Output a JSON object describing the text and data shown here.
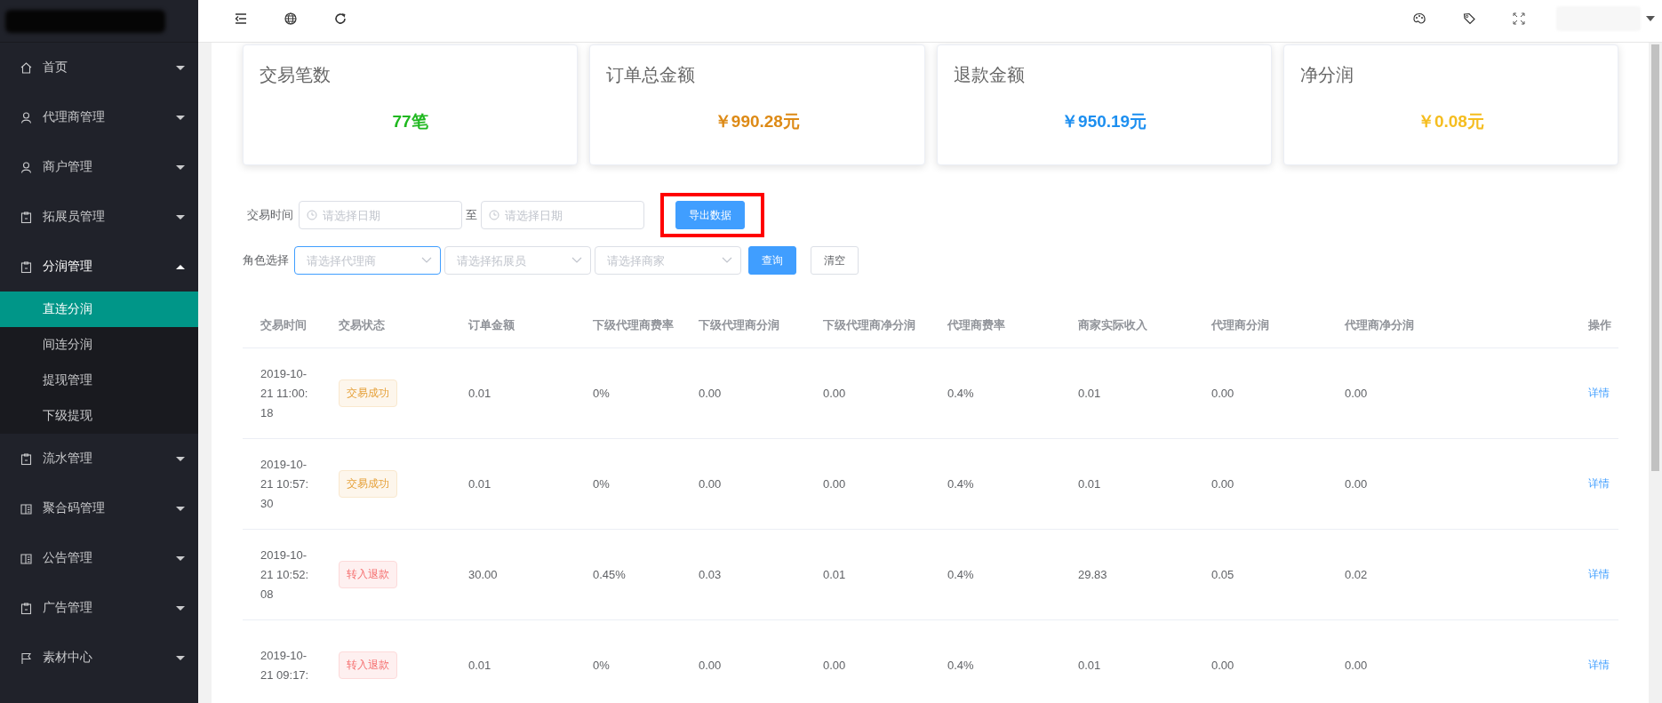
{
  "sidebar": {
    "items": [
      {
        "label": "首页",
        "expanded": false
      },
      {
        "label": "代理商管理",
        "expanded": false
      },
      {
        "label": "商户管理",
        "expanded": false
      },
      {
        "label": "拓展员管理",
        "expanded": false
      },
      {
        "label": "分润管理",
        "expanded": true,
        "children": [
          {
            "label": "直连分润",
            "selected": true
          },
          {
            "label": "间连分润",
            "selected": false
          },
          {
            "label": "提现管理",
            "selected": false
          },
          {
            "label": "下级提现",
            "selected": false
          }
        ]
      },
      {
        "label": "流水管理",
        "expanded": false
      },
      {
        "label": "聚合码管理",
        "expanded": false
      },
      {
        "label": "公告管理",
        "expanded": false
      },
      {
        "label": "广告管理",
        "expanded": false
      },
      {
        "label": "素材中心",
        "expanded": false
      }
    ]
  },
  "stats": [
    {
      "label": "交易笔数",
      "value": "77笔",
      "color": "#1fb81f"
    },
    {
      "label": "订单总金额",
      "value": "￥990.28元",
      "color": "#dd8a16"
    },
    {
      "label": "退款金额",
      "value": "￥950.19元",
      "color": "#1d8ff0"
    },
    {
      "label": "净分润",
      "value": "￥0.08元",
      "color": "#f5bd1f"
    }
  ],
  "filters": {
    "date_label": "交易时间",
    "date_from": {
      "placeholder": "请选择日期"
    },
    "date_sep": "至",
    "date_to": {
      "placeholder": "请选择日期"
    },
    "export_button": "导出数据",
    "export_highlighted": true,
    "role_label": "角色选择",
    "selects": [
      {
        "placeholder": "请选择代理商",
        "focused": true
      },
      {
        "placeholder": "请选择拓展员",
        "focused": false
      },
      {
        "placeholder": "请选择商家",
        "focused": false
      }
    ],
    "query_button": "查询",
    "clear_button": "清空"
  },
  "table": {
    "columns": [
      "交易时间",
      "交易状态",
      "订单金额",
      "下级代理商费率",
      "下级代理商分润",
      "下级代理商净分润",
      "代理商费率",
      "商家实际收入",
      "代理商分润",
      "代理商净分润",
      "操作"
    ],
    "rows": [
      {
        "color": "#e6a23c",
        "cells": [
          "2019-10-21 11:00:18",
          "交易成功",
          "0.01",
          "0%",
          "0.00",
          "0.00",
          "0.4%",
          "0.01",
          "0.00",
          "0.00",
          "详情"
        ]
      },
      {
        "color": "#e6a23c",
        "cells": [
          "2019-10-21 10:57:30",
          "交易成功",
          "0.01",
          "0%",
          "0.00",
          "0.00",
          "0.4%",
          "0.01",
          "0.00",
          "0.00",
          "详情"
        ]
      },
      {
        "color": "#f56c6c",
        "cells": [
          "2019-10-21 10:52:08",
          "转入退款",
          "30.00",
          "0.45%",
          "0.03",
          "0.01",
          "0.4%",
          "29.83",
          "0.05",
          "0.02",
          "详情"
        ]
      },
      {
        "color": "#f56c6c",
        "cells": [
          "2019-10-21 09:17:",
          "转入退款",
          "0.01",
          "0%",
          "0.00",
          "0.00",
          "0.4%",
          "0.01",
          "0.00",
          "0.00",
          "详情"
        ]
      }
    ]
  }
}
